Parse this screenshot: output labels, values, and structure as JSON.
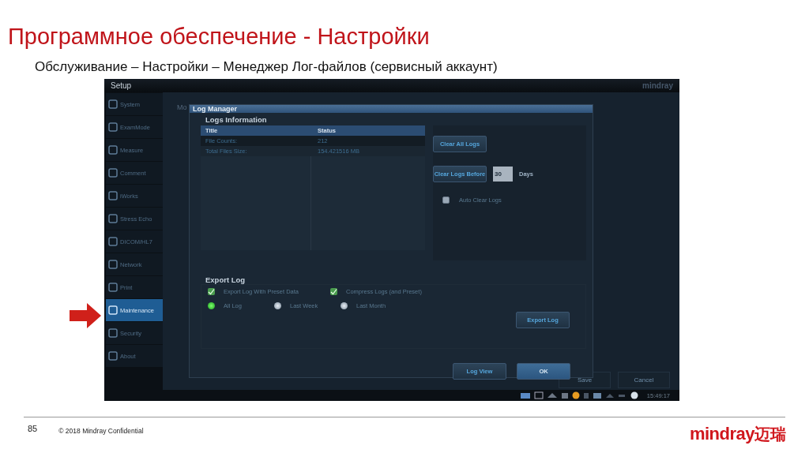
{
  "slide": {
    "title": "Программное обеспечение - Настройки",
    "subtitle": "Обслуживание – Настройки – Менеджер Лог-файлов (сервисный аккаунт)",
    "page_number": "85",
    "footer": "© 2018  Mindray Confidential",
    "logo": {
      "latin": "mindray",
      "chinese": "迈瑞"
    }
  },
  "screen": {
    "header": {
      "title": "Setup",
      "brand": "mindray"
    },
    "sidebar": [
      {
        "label": "System",
        "selected": false
      },
      {
        "label": "ExamMode",
        "selected": false
      },
      {
        "label": "Measure",
        "selected": false
      },
      {
        "label": "Comment",
        "selected": false
      },
      {
        "label": "iWorks",
        "selected": false
      },
      {
        "label": "Stress Echo",
        "selected": false
      },
      {
        "label": "DICOM/HL7",
        "selected": false
      },
      {
        "label": "Network",
        "selected": false
      },
      {
        "label": "Print",
        "selected": false
      },
      {
        "label": "Maintenance",
        "selected": true
      },
      {
        "label": "Security",
        "selected": false
      },
      {
        "label": "About",
        "selected": false
      }
    ],
    "background_label": "Mo",
    "footer_buttons": [
      "Save",
      "Cancel"
    ],
    "clock": "15:49:17",
    "dialog": {
      "title": "Log Manager",
      "logs_information": {
        "heading": "Logs Information",
        "columns": [
          "Title",
          "Status"
        ],
        "rows": [
          [
            "File Counts:",
            "212"
          ],
          [
            "Total Files Size:",
            "154.421516 MB"
          ]
        ]
      },
      "clear_all_button": "Clear All Logs",
      "clear_before_button": "Clear Logs Before",
      "days_value": "30",
      "days_label": "Days",
      "auto_clear": {
        "label": "Auto Clear Logs",
        "checked": false
      },
      "export": {
        "heading": "Export Log",
        "options": [
          {
            "label": "Export Log With Preset Data",
            "checked": true
          },
          {
            "label": "Compress Logs (and Preset)",
            "checked": true
          }
        ],
        "ranges": [
          {
            "label": "All Log",
            "selected": true
          },
          {
            "label": "Last Week",
            "selected": false
          },
          {
            "label": "Last Month",
            "selected": false
          }
        ],
        "button": "Export Log"
      },
      "buttons": [
        "Log View",
        "OK"
      ]
    }
  }
}
